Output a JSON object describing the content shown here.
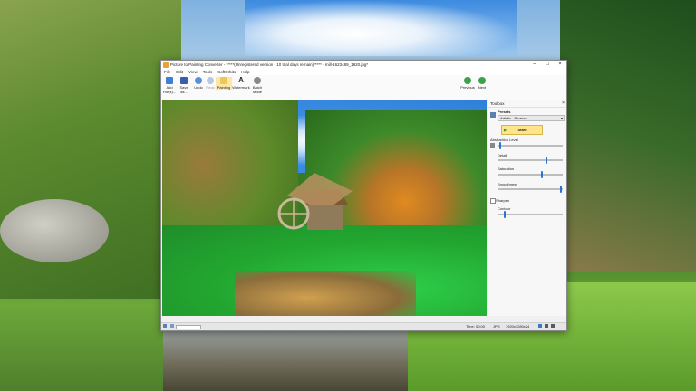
{
  "window": {
    "title": "Picture to Painting Converter - *****(Unregistered version - 10 trial days remain)***** - mill-1623489_1920.jpg*"
  },
  "menu": [
    "File",
    "Edit",
    "View",
    "Tools",
    "SoftOrbits",
    "Help"
  ],
  "toolbar": {
    "add_label": "Add File(s)...",
    "save_label": "Save as...",
    "undo_label": "Undo",
    "redo_label": "Redo",
    "painting_label": "Painting",
    "watermark_label": "Watermark",
    "batch_label": "Batch Mode",
    "previous_label": "Previous",
    "next_label": "Next"
  },
  "toolbox": {
    "title": "Toolbox",
    "presets_label": "Presets",
    "preset_value": "Artistic - Picasso",
    "start_label": "Start",
    "abstraction_label": "Abstraction Level",
    "abstraction_value": 0.03,
    "detail_label": "Detail",
    "detail_value": 0.74,
    "saturation_label": "Saturation",
    "saturation_value": 0.66,
    "smoothness_label": "Smoothness",
    "smoothness_value": 0.96,
    "sharpen_label": "Sharpen",
    "contour_label": "Contour",
    "contour_value": 0.1
  },
  "status": {
    "time": "Time: 00:00",
    "format": "JPG",
    "dimensions": "1920x1280x24"
  },
  "colors": {
    "accent": "#2a73d8",
    "start_button": "#ffe48a",
    "active_tool": "#fde7a6"
  }
}
